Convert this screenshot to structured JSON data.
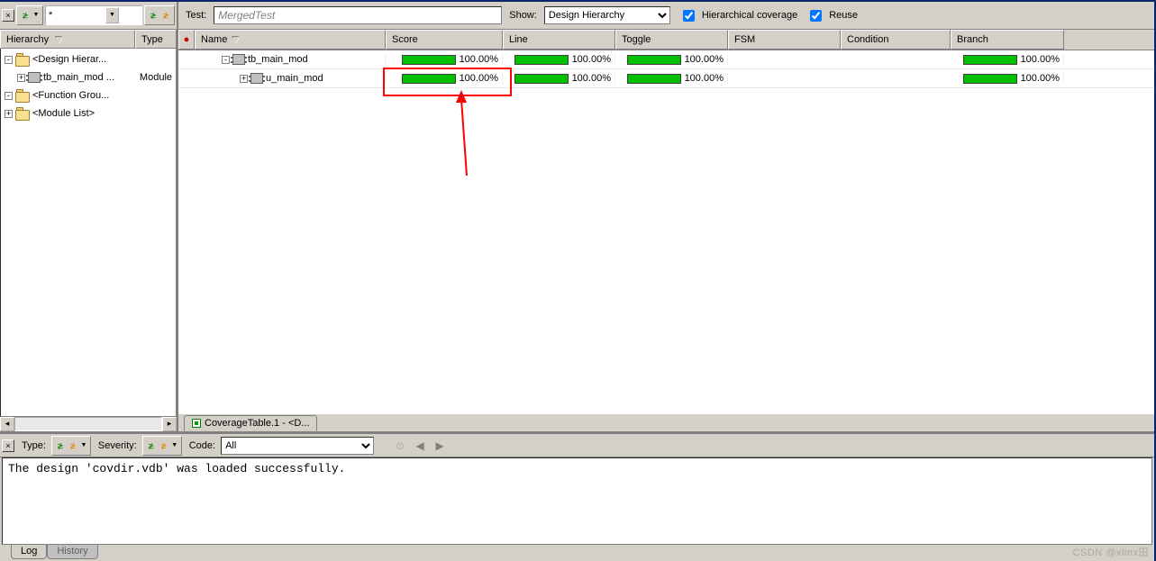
{
  "left_toolbar": {
    "filter_value": "*"
  },
  "hierarchy": {
    "header_name": "Hierarchy",
    "header_type": "Type",
    "nodes": [
      {
        "label": "<Design Hierar...",
        "type": "",
        "icon": "folder",
        "exp": "-"
      },
      {
        "label": "tb_main_mod ...",
        "type": "Module",
        "icon": "module",
        "exp": "+",
        "indent": 1
      },
      {
        "label": "<Function Grou...",
        "type": "",
        "icon": "folder",
        "exp": "-"
      },
      {
        "label": "<Module List>",
        "type": "",
        "icon": "folder",
        "exp": "+"
      }
    ]
  },
  "main_bar": {
    "test_label": "Test:",
    "test_value": "MergedTest",
    "show_label": "Show:",
    "show_value": "Design Hierarchy",
    "hier_cov_label": "Hierarchical coverage",
    "reuse_label": "Reuse"
  },
  "cov_table": {
    "columns": {
      "marker": "●",
      "name": "Name",
      "score": "Score",
      "line": "Line",
      "toggle": "Toggle",
      "fsm": "FSM",
      "cond": "Condition",
      "branch": "Branch"
    },
    "rows": [
      {
        "exp": "-",
        "indent": 1,
        "name": "tb_main_mod",
        "score": "100.00%",
        "line": "100.00%",
        "toggle": "100.00%",
        "fsm": "",
        "cond": "",
        "branch": "100.00%"
      },
      {
        "exp": "+",
        "indent": 2,
        "name": "u_main_mod",
        "score": "100.00%",
        "line": "100.00%",
        "toggle": "100.00%",
        "fsm": "",
        "cond": "",
        "branch": "100.00%"
      }
    ]
  },
  "tab_strip": {
    "tab1": "CoverageTable.1 - <D..."
  },
  "bottom": {
    "type_label": "Type:",
    "severity_label": "Severity:",
    "code_label": "Code:",
    "code_value": "All",
    "log_text": "The design 'covdir.vdb' was loaded successfully.",
    "tab_log": "Log",
    "tab_history": "History"
  },
  "watermark": "CSDN @xlinx田"
}
